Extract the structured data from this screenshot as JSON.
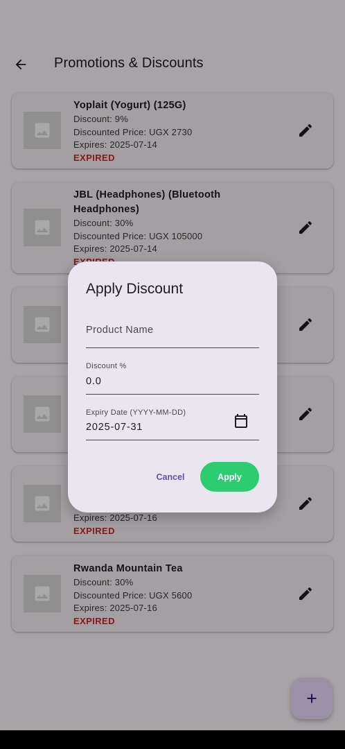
{
  "app_bar": {
    "title": "Promotions & Discounts"
  },
  "products": [
    {
      "name": "Yoplait (Yogurt) (125G)",
      "discount": "Discount: 9%",
      "price": "Discounted Price: UGX 2730",
      "expires": "Expires: 2025-07-14",
      "status": "EXPIRED"
    },
    {
      "name": "JBL (Headphones) (Bluetooth Headphones)",
      "discount": "Discount: 30%",
      "price": "Discounted Price: UGX 105000",
      "expires": "Expires: 2025-07-14",
      "status": "EXPIRED"
    },
    {
      "expires": "Expires: 2025-07-16",
      "status": "EXPIRED"
    },
    {
      "name": "Rwanda Mountain Tea",
      "discount": "Discount: 30%",
      "price": "Discounted Price: UGX 5600",
      "expires": "Expires: 2025-07-16",
      "status": "EXPIRED"
    }
  ],
  "dialog": {
    "title": "Apply Discount",
    "product_name_label": "Product Name",
    "discount_label": "Discount %",
    "discount_value": "0.0",
    "expiry_label": "Expiry Date (YYYY-MM-DD)",
    "expiry_value": "2025-07-31",
    "cancel_label": "Cancel",
    "apply_label": "Apply"
  },
  "icons": {
    "back": "arrow-back-icon",
    "edit": "edit-icon",
    "image": "image-icon",
    "calendar": "calendar-icon",
    "add": "add-icon"
  },
  "colors": {
    "accent": "#6750a4",
    "apply_button": "#2ecc71",
    "expired": "#c62828",
    "fab": "#eaddff"
  }
}
